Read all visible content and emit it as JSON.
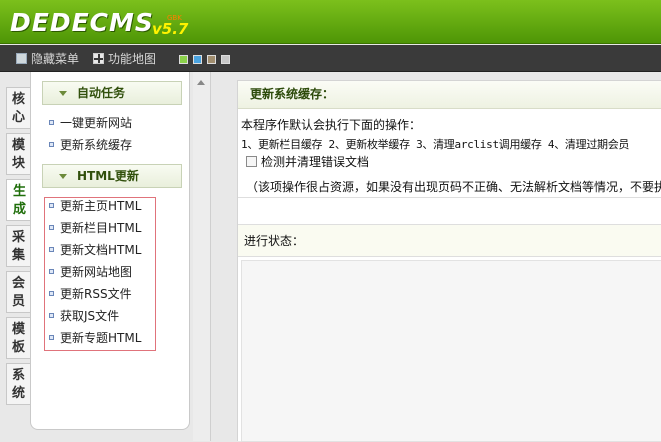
{
  "header": {
    "logo_text": "DEDECMS",
    "version": "v5.7",
    "version_sup": "GBK"
  },
  "toolbar": {
    "hide_menu_label": "隐藏菜单",
    "function_map_label": "功能地图",
    "skin_colors": [
      "#8bd14a",
      "#4aa3df",
      "#a08d6e",
      "#c8c8c8"
    ]
  },
  "vtabs": [
    {
      "label": "核心",
      "active": false
    },
    {
      "label": "模块",
      "active": false
    },
    {
      "label": "生成",
      "active": true
    },
    {
      "label": "采集",
      "active": false
    },
    {
      "label": "会员",
      "active": false
    },
    {
      "label": "模板",
      "active": false
    },
    {
      "label": "系统",
      "active": false
    }
  ],
  "menu": {
    "section_auto": "自动任务",
    "auto_items": [
      "一键更新网站",
      "更新系统缓存"
    ],
    "section_html": "HTML更新",
    "html_items": [
      "更新主页HTML",
      "更新栏目HTML",
      "更新文档HTML",
      "更新网站地图",
      "更新RSS文件",
      "获取JS文件",
      "更新专题HTML"
    ]
  },
  "main": {
    "title": "更新系统缓存：",
    "desc": "本程序作默认会执行下面的操作：",
    "ops": "1、更新栏目缓存 2、更新枚举缓存 3、清理arclist调用缓存 4、清理过期会员",
    "check_label": "检测并清理错误文档",
    "note": "（该项操作很占资源，如果没有出现页码不正确、无法解析文档等情况，不要执",
    "status_label": "进行状态："
  }
}
